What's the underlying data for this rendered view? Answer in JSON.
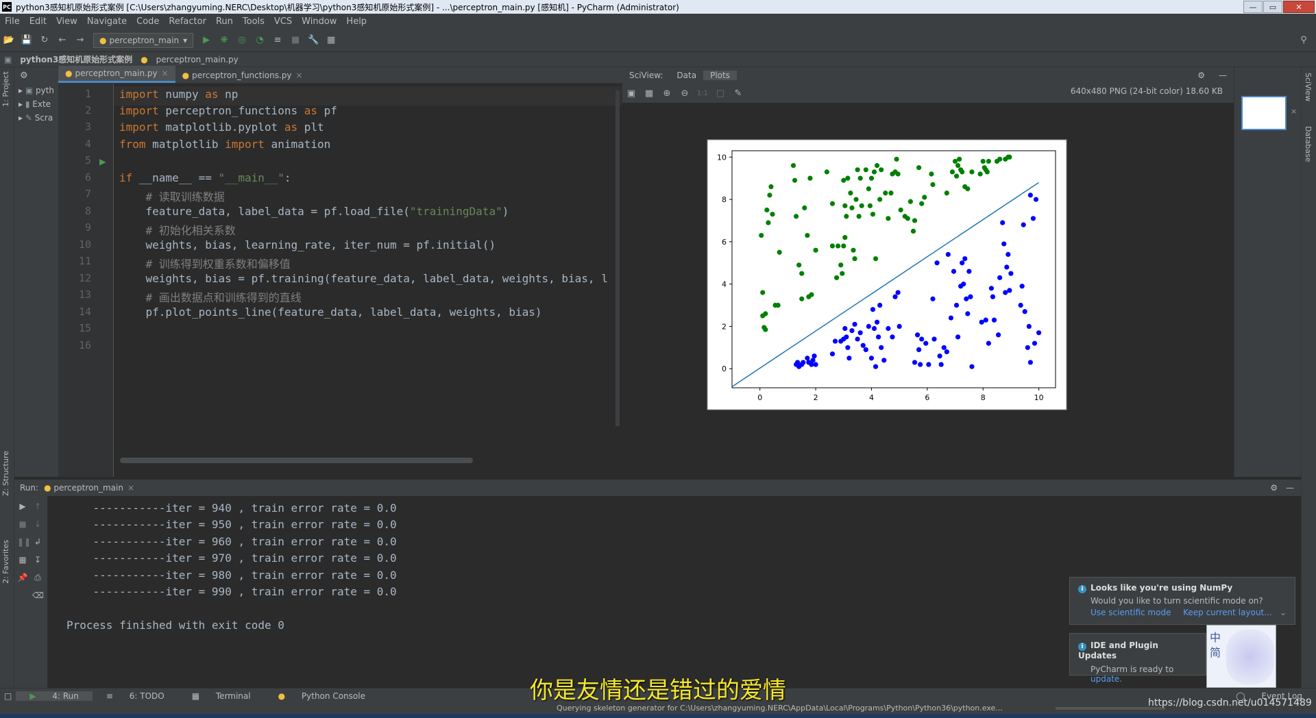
{
  "window": {
    "title": "python3感知机原始形式案例 [C:\\Users\\zhangyuming.NERC\\Desktop\\机器学习\\python3感知机原始形式案例] - ...\\perceptron_main.py [感知机] - PyCharm (Administrator)",
    "logo": "PC",
    "minimize": "—",
    "maximize": "▭",
    "close": "✕"
  },
  "menu": [
    "File",
    "Edit",
    "View",
    "Navigate",
    "Code",
    "Refactor",
    "Run",
    "Tools",
    "VCS",
    "Window",
    "Help"
  ],
  "toolbar": {
    "run_config": "perceptron_main"
  },
  "breadcrumb": [
    "python3感知机原始形式案例",
    "perceptron_main.py"
  ],
  "left_strip": {
    "project": "1: Project",
    "structure": "Z: Structure",
    "favorites": "2: Favorites"
  },
  "project_tree": [
    "pyth",
    "Exte",
    "Scra"
  ],
  "editor_tabs": [
    {
      "label": "perceptron_main.py",
      "active": true
    },
    {
      "label": "perceptron_functions.py",
      "active": false
    }
  ],
  "code": {
    "line_numbers": [
      "1",
      "2",
      "3",
      "4",
      "5",
      "6",
      "7",
      "8",
      "9",
      "10",
      "11",
      "12",
      "13",
      "14",
      "15",
      "16"
    ],
    "l1_kw": "import",
    "l1_rest": " numpy ",
    "l1_as": "as",
    "l1_end": " np",
    "l2_kw": "import",
    "l2_rest": " perceptron_functions ",
    "l2_as": "as",
    "l2_end": " pf",
    "l3_kw": "import",
    "l3_rest": " matplotlib.pyplot ",
    "l3_as": "as",
    "l3_end": " plt",
    "l4_kw": "from",
    "l4_rest": " matplotlib ",
    "l4_imp": "import",
    "l4_end": " animation",
    "l6_kw": "if",
    "l6_rest": " __name__ == ",
    "l6_str": "\"__main__\"",
    "l6_end": ":",
    "l7": "    # 读取训练数据",
    "l8_a": "    feature_data, label_data = pf.load_file(",
    "l8_str": "\"trainingData\"",
    "l8_b": ")",
    "l9": "    # 初始化相关系数",
    "l10": "    weights, bias, learning_rate, iter_num = pf.initial()",
    "l11": "    # 训练得到权重系数和偏移值",
    "l12": "    weights, bias = pf.training(feature_data, label_data, weights, bias, l",
    "l13": "    # 画出数据点和训练得到的直线",
    "l14": "    pf.plot_points_line(feature_data, label_data, weights, bias)"
  },
  "sciview": {
    "label": "SciView:",
    "tabs": [
      "Data",
      "Plots"
    ],
    "image_info": "640x480 PNG (24-bit color) 18.60 KB",
    "strip_label": "SciView",
    "database_label": "Database"
  },
  "chart_data": {
    "type": "scatter",
    "xlim": [
      -1.0,
      10.6
    ],
    "ylim": [
      -0.9,
      10.3
    ],
    "xticks": [
      "0",
      "2",
      "4",
      "6",
      "8",
      "10"
    ],
    "yticks": [
      "0",
      "2",
      "4",
      "6",
      "8",
      "10"
    ],
    "xtick_values": [
      0,
      2,
      4,
      6,
      8,
      10
    ],
    "ytick_values": [
      0,
      2,
      4,
      6,
      8,
      10
    ],
    "line": {
      "x": [
        -1.0,
        10.0
      ],
      "y": [
        -0.85,
        8.8
      ],
      "color": "#1f77b4"
    },
    "series": [
      {
        "color": "#008000",
        "points": [
          [
            0.05,
            6.3
          ],
          [
            0.1,
            3.6
          ],
          [
            0.1,
            2.5
          ],
          [
            0.2,
            2.6
          ],
          [
            0.15,
            1.95
          ],
          [
            0.2,
            1.85
          ],
          [
            0.25,
            7.5
          ],
          [
            0.3,
            6.9
          ],
          [
            0.35,
            8.2
          ],
          [
            0.4,
            8.6
          ],
          [
            0.45,
            7.3
          ],
          [
            0.55,
            3.0
          ],
          [
            0.65,
            3.0
          ],
          [
            0.7,
            5.5
          ],
          [
            1.2,
            9.6
          ],
          [
            1.25,
            8.9
          ],
          [
            1.3,
            7.2
          ],
          [
            1.4,
            4.9
          ],
          [
            1.5,
            4.5
          ],
          [
            1.5,
            3.3
          ],
          [
            1.6,
            7.6
          ],
          [
            1.7,
            6.3
          ],
          [
            1.75,
            3.4
          ],
          [
            1.8,
            9.0
          ],
          [
            1.85,
            3.5
          ],
          [
            2.0,
            5.6
          ],
          [
            2.4,
            9.3
          ],
          [
            2.6,
            7.8
          ],
          [
            2.6,
            5.8
          ],
          [
            2.75,
            4.3
          ],
          [
            2.8,
            5.8
          ],
          [
            2.9,
            4.9
          ],
          [
            2.95,
            4.5
          ],
          [
            3.0,
            5.8
          ],
          [
            3.0,
            8.9
          ],
          [
            3.05,
            7.7
          ],
          [
            3.05,
            6.2
          ],
          [
            3.1,
            7.2
          ],
          [
            3.15,
            9.0
          ],
          [
            3.25,
            8.3
          ],
          [
            3.3,
            7.6
          ],
          [
            3.35,
            5.6
          ],
          [
            3.4,
            5.2
          ],
          [
            3.45,
            8.0
          ],
          [
            3.5,
            9.4
          ],
          [
            3.55,
            7.2
          ],
          [
            3.6,
            9.0
          ],
          [
            3.65,
            7.7
          ],
          [
            3.8,
            9.4
          ],
          [
            3.9,
            8.5
          ],
          [
            3.95,
            7.7
          ],
          [
            4.0,
            9.0
          ],
          [
            4.05,
            7.3
          ],
          [
            4.1,
            9.3
          ],
          [
            4.15,
            5.2
          ],
          [
            4.2,
            9.6
          ],
          [
            4.3,
            8.0
          ],
          [
            4.35,
            9.4
          ],
          [
            4.5,
            8.3
          ],
          [
            4.6,
            7.1
          ],
          [
            4.7,
            8.3
          ],
          [
            4.75,
            9.2
          ],
          [
            4.85,
            9.3
          ],
          [
            4.9,
            9.9
          ],
          [
            4.95,
            9.2
          ],
          [
            5.05,
            7.5
          ],
          [
            5.2,
            7.2
          ],
          [
            5.3,
            7.1
          ],
          [
            5.4,
            7.9
          ],
          [
            5.5,
            6.5
          ],
          [
            5.55,
            7.0
          ],
          [
            5.7,
            9.5
          ],
          [
            5.8,
            7.8
          ],
          [
            5.9,
            8.1
          ],
          [
            6.15,
            9.2
          ],
          [
            6.2,
            8.7
          ],
          [
            6.7,
            8.3
          ],
          [
            6.9,
            9.3
          ],
          [
            7.0,
            9.8
          ],
          [
            7.05,
            9.1
          ],
          [
            7.1,
            9.6
          ],
          [
            7.15,
            9.9
          ],
          [
            7.2,
            9.4
          ],
          [
            7.25,
            9.3
          ],
          [
            7.35,
            8.6
          ],
          [
            7.45,
            8.5
          ],
          [
            7.6,
            9.3
          ],
          [
            7.9,
            9.2
          ],
          [
            8.0,
            9.8
          ],
          [
            8.05,
            9.5
          ],
          [
            8.1,
            9.4
          ],
          [
            8.15,
            9.3
          ],
          [
            8.2,
            9.8
          ],
          [
            8.5,
            9.8
          ],
          [
            8.6,
            9.9
          ],
          [
            8.8,
            9.9
          ],
          [
            8.9,
            10.0
          ],
          [
            8.95,
            10.0
          ]
        ]
      },
      {
        "color": "#0000ff",
        "points": [
          [
            1.3,
            0.2
          ],
          [
            1.35,
            0.3
          ],
          [
            1.4,
            0.1
          ],
          [
            1.5,
            0.2
          ],
          [
            1.55,
            0.3
          ],
          [
            1.7,
            0.5
          ],
          [
            1.75,
            0.3
          ],
          [
            1.85,
            0.2
          ],
          [
            1.9,
            0.4
          ],
          [
            1.95,
            0.6
          ],
          [
            2.0,
            0.2
          ],
          [
            2.6,
            0.7
          ],
          [
            2.7,
            1.3
          ],
          [
            2.9,
            1.3
          ],
          [
            3.0,
            1.4
          ],
          [
            3.05,
            1.9
          ],
          [
            3.1,
            1.5
          ],
          [
            3.15,
            1.0
          ],
          [
            3.2,
            0.5
          ],
          [
            3.3,
            1.8
          ],
          [
            3.4,
            2.1
          ],
          [
            3.5,
            1.4
          ],
          [
            3.6,
            1.7
          ],
          [
            3.7,
            1.1
          ],
          [
            3.8,
            0.9
          ],
          [
            3.9,
            2.0
          ],
          [
            4.0,
            0.5
          ],
          [
            4.05,
            2.8
          ],
          [
            4.1,
            1.9
          ],
          [
            4.15,
            0.1
          ],
          [
            4.2,
            2.2
          ],
          [
            4.25,
            1.5
          ],
          [
            4.3,
            3.0
          ],
          [
            4.35,
            1.0
          ],
          [
            4.45,
            0.4
          ],
          [
            4.6,
            1.9
          ],
          [
            4.75,
            1.5
          ],
          [
            4.85,
            3.4
          ],
          [
            4.95,
            3.6
          ],
          [
            5.0,
            2.0
          ],
          [
            5.55,
            0.3
          ],
          [
            5.65,
            1.6
          ],
          [
            5.7,
            0.9
          ],
          [
            5.75,
            0.2
          ],
          [
            5.8,
            1.4
          ],
          [
            5.95,
            1.2
          ],
          [
            6.05,
            0.2
          ],
          [
            6.2,
            3.3
          ],
          [
            6.25,
            1.4
          ],
          [
            6.35,
            5.0
          ],
          [
            6.45,
            0.6
          ],
          [
            6.5,
            0.2
          ],
          [
            6.6,
            1.0
          ],
          [
            6.7,
            0.8
          ],
          [
            6.75,
            5.4
          ],
          [
            6.85,
            2.4
          ],
          [
            6.95,
            4.6
          ],
          [
            7.05,
            3.0
          ],
          [
            7.1,
            1.5
          ],
          [
            7.2,
            3.9
          ],
          [
            7.25,
            5.0
          ],
          [
            7.3,
            4.0
          ],
          [
            7.35,
            5.2
          ],
          [
            7.4,
            3.3
          ],
          [
            7.45,
            2.6
          ],
          [
            7.5,
            4.6
          ],
          [
            7.55,
            3.4
          ],
          [
            7.6,
            0.1
          ],
          [
            7.95,
            2.2
          ],
          [
            8.1,
            2.3
          ],
          [
            8.2,
            1.2
          ],
          [
            8.3,
            3.8
          ],
          [
            8.35,
            3.4
          ],
          [
            8.4,
            2.3
          ],
          [
            8.55,
            1.6
          ],
          [
            8.6,
            4.3
          ],
          [
            8.7,
            6.9
          ],
          [
            8.75,
            5.9
          ],
          [
            8.8,
            3.6
          ],
          [
            8.85,
            4.8
          ],
          [
            8.9,
            5.4
          ],
          [
            8.95,
            3.7
          ],
          [
            9.0,
            4.5
          ],
          [
            9.35,
            3.0
          ],
          [
            9.4,
            3.9
          ],
          [
            9.45,
            6.8
          ],
          [
            9.5,
            2.7
          ],
          [
            9.6,
            1.0
          ],
          [
            9.65,
            2.0
          ],
          [
            9.7,
            0.3
          ],
          [
            9.7,
            8.2
          ],
          [
            9.8,
            7.1
          ],
          [
            9.85,
            1.2
          ],
          [
            9.9,
            8.0
          ],
          [
            10.0,
            1.7
          ]
        ]
      }
    ]
  },
  "run": {
    "label": "Run:",
    "tab": "perceptron_main",
    "lines": [
      "    -----------iter = 940 , train error rate = 0.0",
      "    -----------iter = 950 , train error rate = 0.0",
      "    -----------iter = 960 , train error rate = 0.0",
      "    -----------iter = 970 , train error rate = 0.0",
      "    -----------iter = 980 , train error rate = 0.0",
      "    -----------iter = 990 , train error rate = 0.0"
    ],
    "exit": "Process finished with exit code 0"
  },
  "notifications": {
    "numpy_title": "Looks like you're using NumPy",
    "numpy_body": "Would you like to turn scientific mode on?",
    "numpy_link1": "Use scientific mode",
    "numpy_link2": "Keep current layout...",
    "update_title": "IDE and Plugin Updates",
    "update_body": "PyCharm is ready to",
    "update_link": "update."
  },
  "bottom_tabs": [
    "4: Run",
    "6: TODO",
    "Terminal",
    "Python Console"
  ],
  "event_log": "Event Log",
  "status": "Querying skeleton generator for C:\\Users\\zhangyuming.NERC\\AppData\\Local\\Programs\\Python\\Python36\\python.exe...",
  "subtitle": "你是友情还是错过的爱情",
  "watermark": "https://blog.csdn.net/u014571489",
  "ime": {
    "char1": "中",
    "char2": "简"
  },
  "colors": {
    "keyword": "#cc7832",
    "comment": "#808080",
    "string": "#6a8759",
    "accent": "#4a88c7"
  }
}
